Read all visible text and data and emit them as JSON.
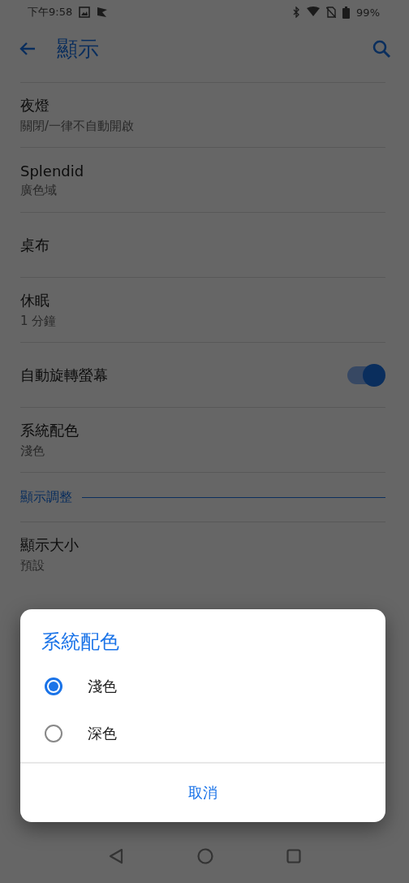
{
  "status_bar": {
    "time": "下午9:58",
    "battery": "99%"
  },
  "toolbar": {
    "title": "顯示"
  },
  "settings": [
    {
      "kind": "item",
      "title": "夜燈",
      "subtitle": "關閉/一律不自動開啟"
    },
    {
      "kind": "item",
      "title": "Splendid",
      "subtitle": "廣色域"
    },
    {
      "kind": "item",
      "title": "桌布"
    },
    {
      "kind": "item",
      "title": "休眠",
      "subtitle": "1 分鐘"
    },
    {
      "kind": "toggle",
      "title": "自動旋轉螢幕",
      "on": true
    },
    {
      "kind": "item",
      "title": "系統配色",
      "subtitle": "淺色"
    },
    {
      "kind": "header",
      "title": "顯示調整"
    },
    {
      "kind": "item",
      "title": "顯示大小",
      "subtitle": "預設"
    }
  ],
  "dialog": {
    "title": "系統配色",
    "options": [
      {
        "label": "淺色",
        "selected": true
      },
      {
        "label": "深色",
        "selected": false
      }
    ],
    "button": "取消"
  }
}
